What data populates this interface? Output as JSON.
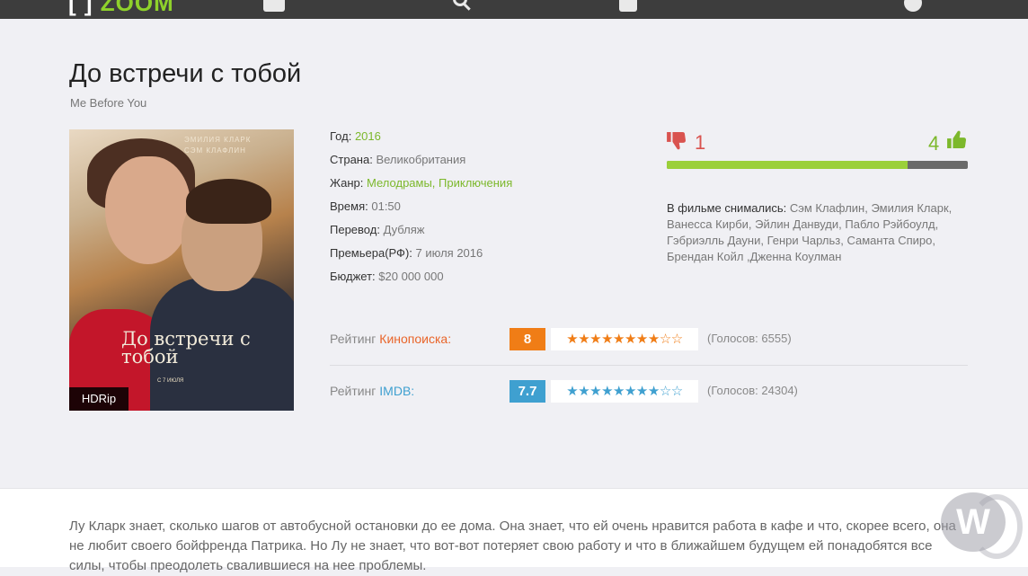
{
  "header": {
    "logo_bracket": "[ ]",
    "logo_text": "ZOOM"
  },
  "movie": {
    "title": "До встречи с тобой",
    "original_title": "Me Before You",
    "poster": {
      "quality_badge": "HDRip",
      "cast_text": "ЭМИЛИЯ КЛАРК\nСЭМ КЛАФЛИН",
      "title_text": "До встречи с тобой",
      "bottom_text": "С 7 ИЮЛЯ"
    },
    "info": {
      "year_label": "Год:",
      "year": "2016",
      "country_label": "Страна:",
      "country": "Великобритания",
      "genre_label": "Жанр:",
      "genre": "Мелодрамы, Приключения",
      "time_label": "Время:",
      "time": "01:50",
      "translation_label": "Перевод:",
      "translation": "Дубляж",
      "premiere_label": "Премьера(РФ):",
      "premiere": "7 июля 2016",
      "budget_label": "Бюджет:",
      "budget": "$20 000 000"
    },
    "votes": {
      "dislikes": "1",
      "likes": "4",
      "like_fraction": 0.8
    },
    "actors": {
      "label": "В фильме снимались:",
      "list": "Сэм Клафлин, Эмилия Кларк, Ванесса Кирби, Эйлин Данвуди, Пабло Рэйбоулд, Гэбриэлль Дауни, Генри Чарльз, Саманта Спиро, Брендан Койл ,Дженна Коулман"
    },
    "ratings": {
      "kinopoisk": {
        "label_prefix": "Рейтинг",
        "source": "Кинопоиска",
        "suffix": ":",
        "score": "8",
        "stars": "★★★★★★★★☆☆",
        "votes": "(Голосов: 6555)",
        "color": "#f07d16"
      },
      "imdb": {
        "label_prefix": "Рейтинг",
        "source": "IMDB",
        "suffix": ":",
        "score": "7.7",
        "stars": "★★★★★★★★☆☆",
        "votes": "(Голосов: 24304)",
        "color": "#3fa0d0"
      }
    },
    "description": "Лу Кларк знает, сколько шагов от автобусной остановки до ее дома. Она знает, что ей очень нравится работа в кафе и что, скорее всего, она не любит своего бойфренда Патрика. Но Лу не знает, что вот-вот потеряет свою работу и что в ближайшем будущем ей понадобятся все силы, чтобы преодолеть свалившиеся на нее проблемы."
  },
  "watermark": {
    "letter": "W"
  },
  "colors": {
    "accent_green": "#7cb82b",
    "dislike_red": "#d9534f",
    "topbar": "#3d3d3d"
  }
}
